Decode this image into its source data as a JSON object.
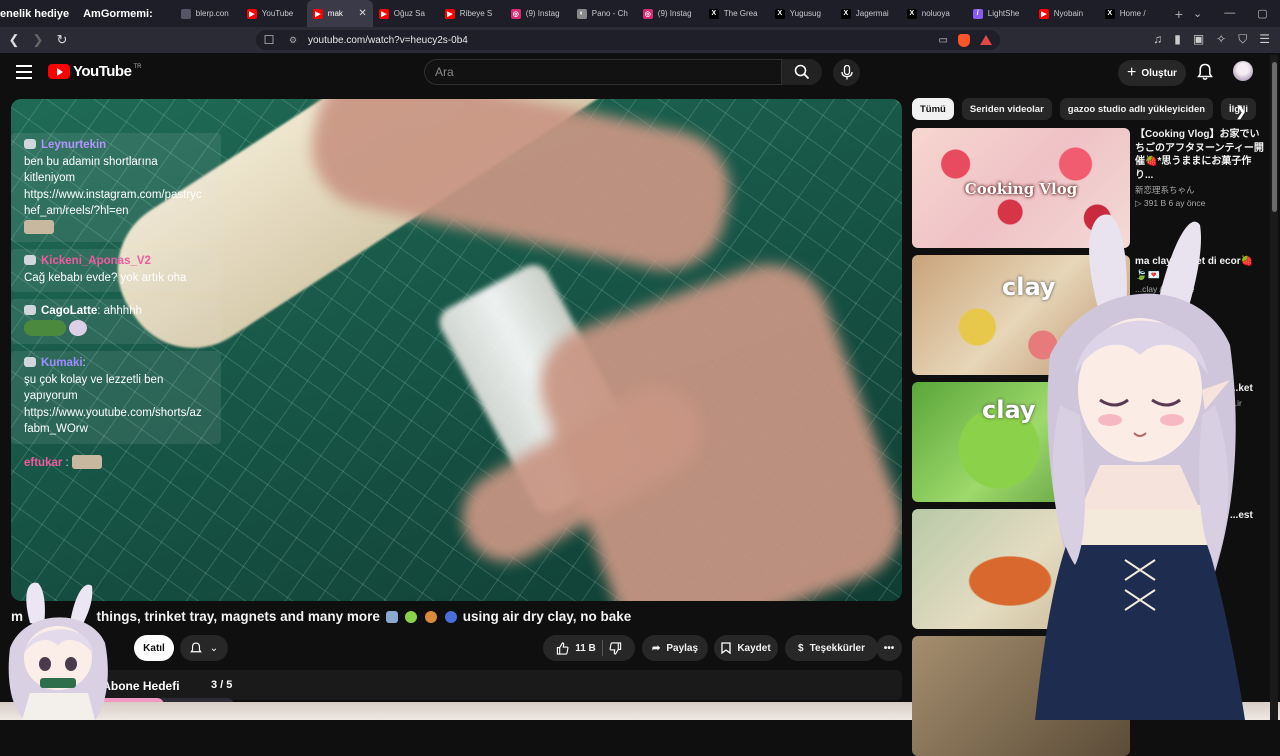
{
  "browser": {
    "promo_text": [
      "enelik hediye",
      "AmGormemi:"
    ],
    "tabs": [
      {
        "title": "blerp.con",
        "fav": "#555566",
        "glyph": ""
      },
      {
        "title": "YouTube",
        "fav": "#ff0000",
        "glyph": "▶"
      },
      {
        "title": "mak",
        "fav": "#ff0000",
        "glyph": "▶",
        "active": true
      },
      {
        "title": "Oğuz Sa",
        "fav": "#ff0000",
        "glyph": "▶"
      },
      {
        "title": "Ribeye S",
        "fav": "#ff0000",
        "glyph": "▶"
      },
      {
        "title": "(9) Instag",
        "fav": "#d62976",
        "glyph": "◎"
      },
      {
        "title": "Pano - Ch",
        "fav": "#888888",
        "glyph": "◐"
      },
      {
        "title": "(9) Instag",
        "fav": "#d62976",
        "glyph": "◎"
      },
      {
        "title": "The Grea",
        "fav": "#000000",
        "glyph": "X"
      },
      {
        "title": "Yugusug",
        "fav": "#000000",
        "glyph": "X"
      },
      {
        "title": "Jagermai",
        "fav": "#000000",
        "glyph": "X"
      },
      {
        "title": "noluoya",
        "fav": "#000000",
        "glyph": "X"
      },
      {
        "title": "LightShe",
        "fav": "#8a5cf6",
        "glyph": "/"
      },
      {
        "title": "Nyobain",
        "fav": "#ff0000",
        "glyph": "▶"
      },
      {
        "title": "Home / ",
        "fav": "#000000",
        "glyph": "X"
      }
    ],
    "url": "youtube.com/watch?v=heucy2s-0b4"
  },
  "youtube": {
    "logo_text": "YouTube",
    "logo_sup": "TR",
    "search_placeholder": "Ara",
    "create_label": "Oluştur"
  },
  "chat": [
    {
      "user": "Leynurtekin",
      "color": "#b592ff",
      "lines": [
        "ben bu adamin shortlarına",
        "kitleniyom",
        "https://www.instagram.com/pastryc",
        "hef_am/reels/?hl=en"
      ],
      "emote": "emote"
    },
    {
      "user": "Kickeni_Aponas_V2",
      "color": "#f05aa0",
      "lines": [
        "Cağ kebabı evde? yok artık oha"
      ]
    },
    {
      "user": "CagoLatte",
      "color": "#ffffff",
      "inline": "ahhhhh",
      "emote": "pepe"
    },
    {
      "user": "Kumaki",
      "color": "#9c8cff",
      "lines": [
        "şu çok kolay ve lezzetli ben",
        "yapıyorum",
        "https://www.youtube.com/shorts/az",
        "fabm_WOrw"
      ]
    },
    {
      "user": "eftukar",
      "color": "#f05aa0",
      "emote": "emote",
      "plain": true
    }
  ],
  "video": {
    "title_prefix": "m",
    "title_main": "things, trinket tray, magnets and many more",
    "title_suffix": "using air dry clay, no bake",
    "channel_fragment": "udio",
    "join_label": "Katıl",
    "like_count": "11 B",
    "share_label": "Paylaş",
    "save_label": "Kaydet",
    "thanks_label": "Teşekkürler"
  },
  "goal": {
    "label": "Günlük Abone Hedefi",
    "count": "3 / 5",
    "progress_fraction": 0.6,
    "fill_color": "#f09ac3"
  },
  "sidebar": {
    "chips": [
      "Tümü",
      "Seriden videolar",
      "gazoo studio adlı yükleyiciden",
      "İlgili"
    ],
    "videos": [
      {
        "title": "【Cooking Vlog】お家でいちごのアフタヌーンティー開催🍓*思うままにお菓子作り...",
        "channel": "新恋理系ちゃん",
        "meta": "▷ 391 B   6 ay önce",
        "thumb_text": "Cooking Vlog"
      },
      {
        "title": "ma   clay trinket di   ecor🍓🍃💌",
        "channel": "...clay / no bake",
        "meta": "",
        "thumb_text": "clay"
      },
      {
        "title": "...ket",
        "channel": "...ir",
        "meta": "",
        "thumb_text": "clay"
      },
      {
        "title": "...est",
        "channel": "",
        "meta": "",
        "thumb_text": ""
      }
    ]
  }
}
